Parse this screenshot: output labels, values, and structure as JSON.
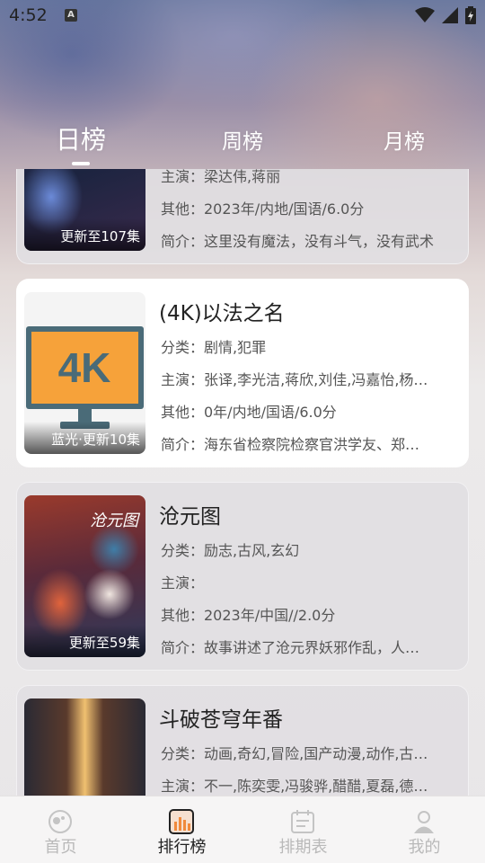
{
  "status_bar": {
    "time": "4:52",
    "a_badge": "A"
  },
  "tabs": [
    {
      "label": "日榜",
      "active": true
    },
    {
      "label": "周榜",
      "active": false
    },
    {
      "label": "月榜",
      "active": false
    }
  ],
  "cards": [
    {
      "title": "",
      "category": "",
      "cast": "主演：梁达伟,蒋丽",
      "other": "其他：2023年/内地/国语/6.0分",
      "intro": "简介：这里没有魔法，没有斗气，没有武术",
      "badge": "更新至107集"
    },
    {
      "title": "(4K)以法之名",
      "category": "分类：剧情,犯罪",
      "cast": "主演：张译,李光洁,蒋欣,刘佳,冯嘉怡,杨…",
      "other": "其他：0年/内地/国语/6.0分",
      "intro": "简介：海东省检察院检察官洪学友、郑…",
      "badge": "蓝光·更新10集",
      "poster_text": "4K"
    },
    {
      "title": "沧元图",
      "category": "分类：励志,古风,玄幻",
      "cast": "主演：",
      "other": "其他：2023年/中国//2.0分",
      "intro": "简介：故事讲述了沧元界妖邪作乱，人…",
      "badge": "更新至59集",
      "poster_text": "沧元图"
    },
    {
      "title": "斗破苍穹年番",
      "category": "分类：动画,奇幻,冒险,国产动漫,动作,古…",
      "cast": "主演：不一,陈奕雯,冯骏骅,醋醋,夏磊,德…",
      "other": "",
      "intro": "",
      "badge": ""
    }
  ],
  "bottom_nav": [
    {
      "label": "首页",
      "icon": "home-icon",
      "active": false
    },
    {
      "label": "排行榜",
      "icon": "ranking-icon",
      "active": true
    },
    {
      "label": "排期表",
      "icon": "calendar-icon",
      "active": false
    },
    {
      "label": "我的",
      "icon": "profile-icon",
      "active": false
    }
  ],
  "colors": {
    "accent": "#f08a3c",
    "poster_4k_bg": "#f6a23a",
    "poster_4k_frame": "#4a6b78"
  }
}
